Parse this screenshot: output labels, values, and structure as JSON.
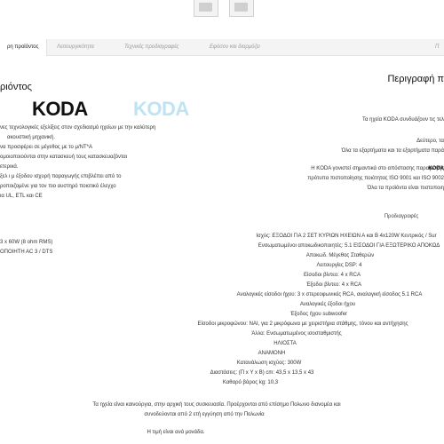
{
  "tabs": [
    {
      "label": "ρη προϊόντος",
      "active": true
    },
    {
      "label": "Λειτουργικότητα"
    },
    {
      "label": "Τεχνικές προδιαγραφές"
    },
    {
      "label": "Εφόσον και διαρμόζει"
    },
    {
      "label": "Π"
    }
  ],
  "left_title": "ριόντος",
  "right_title": "Περιγραφή π",
  "logos": [
    "KODA",
    "KODA"
  ],
  "left_lines": [
    "νες τεχνολογικές εξελίξεις στον σχεδιασμό ηχείων με την καλύτερη",
    "ακουστική μηχανική.",
    "να προσφέρει σε μέγεθος με το μ/ΝΤ*Α",
    "ομοιοποιούνται στην κατασκευή τους κατασκευαζόνται",
    "ετερικά.",
    "ξελ ι μ έξοδου ισχυρή παραγωγής επιβλέπει από το",
    "ροποιζομένε για τον πιο αυστηρό ποιοτικό έλεγχο",
    "ια UL, ETL και CE",
    "3 x 60W (8 ohm RMS)",
    "ΟΠΟΙΗΤΗ ΑC 3 / DTS"
  ],
  "right_lines": [
    "Τα ηχεία KODA συνδυάζουν τις τελ",
    "Δεύτερο, τα",
    "Όλα τα εξαρτήματα και τα εξαρτήματα παρά",
    "",
    "Η KODA γονιστεί σημαντικά στο απόστασης παραγωγής",
    "πρότυπα πιστοποίησης ποιότητας ISO 9001 και ISO 9002",
    "Όλα τα προϊόντα είναι πιστοποιη"
  ],
  "spec_title": "Προδιαγραφές",
  "spec_lines": [
    "Ισχύς: ΕΞΟΔΟΙ ΓΙΑ 2 ΣΕΤ ΚΥΡΙΩΝ ΗΧΕΙΩΝ Α και Β 4x120W Κεντρικός / Sur",
    "Ενσωματωμένοι αποκωδικοποιητές: 5.1 ΕΙΣΟΔΟΙ ΓΙΑ ΕΞΩΤΕΡΙΚΟ ΑΠΟΚΩΔ",
    "Αποκωδ. Μέγεθος Σταθερών",
    "Λειτουργίες DSP: 4",
    "Είσοδοι βίντεο: 4 x RCA",
    "Έξοδοι βίντεο: 4 x RCA",
    "Αναλογικές είσοδοι ήχου: 3 x στερεοφωνικές RCA, αναλογική είσοδος 5.1 RCA",
    "Αναλογικές έξοδοι ήχου",
    "Έξοδος ήχου subwoofer",
    "Είσοδοι μικροφώνου: ΝΑΙ, για 2 μικρόφωνα με χειριστήρια στάθμης, τόνου και αντήχησης",
    "Άλλα: Ενσωματωμένος ισοσταθμιστής",
    "ΗΛΙΟΣΤΑ",
    "ΑΝΑΜΟΝΗ",
    "Κατανάλωση ισχύος: 300W",
    "Διαστάσεις: (Π x Υ x Β) cm: 43,5 x 13,5 x 43",
    "Καθαρό βάρος kg: 10,3"
  ],
  "footer_lines": [
    "Τα ηχεία είναι καινούργια, στην αρχική τους συσκευασία. Προέρχονται από επίσημο Πολωνο διανομέα και",
    "συνοδεύονται από 2 ετή εγγύηση από την Πολωνία"
  ],
  "price_note": "Η τιμή είναι ανά μονάδα."
}
